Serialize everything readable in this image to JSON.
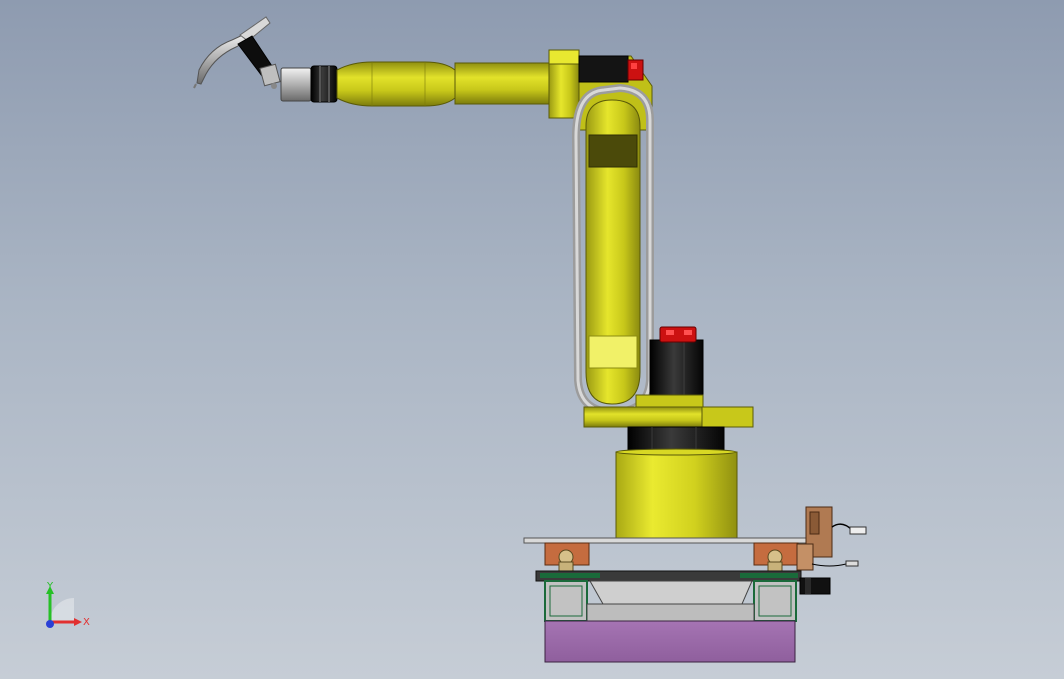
{
  "viewport": {
    "background_top": "#8e9bb0",
    "background_bottom": "#c6cdd6"
  },
  "model": {
    "robot_color": "#c8c81a",
    "cable_color": "#a6a6a6",
    "base_color": "#9a6aa6",
    "motor_color": "#111111",
    "cap_color": "#cc1111"
  },
  "triad": {
    "y_label": "Y",
    "x_label": "X",
    "y_color": "#26c026",
    "x_color": "#e23030",
    "z_color": "#2a3fd6",
    "icon": "coordinate-triad-icon"
  }
}
